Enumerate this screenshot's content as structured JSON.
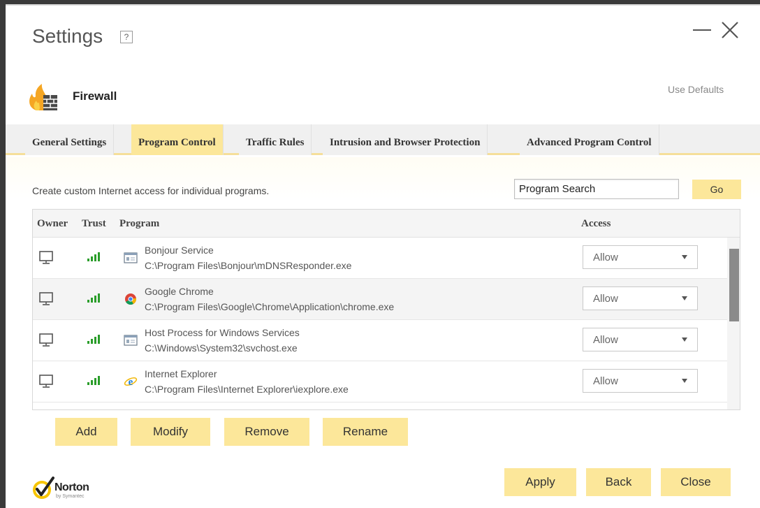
{
  "window": {
    "title": "Settings",
    "help_label": "?",
    "colors": {
      "accent": "#fce79a",
      "tab_active": "#fce79a"
    }
  },
  "section": {
    "title": "Firewall",
    "icon": "flame-wall-icon",
    "use_defaults": "Use Defaults"
  },
  "tabs": [
    {
      "label": "General Settings",
      "active": false
    },
    {
      "label": "Program Control",
      "active": true
    },
    {
      "label": "Traffic Rules",
      "active": false
    },
    {
      "label": "Intrusion and Browser Protection",
      "active": false
    },
    {
      "label": "Advanced Program Control",
      "active": false
    }
  ],
  "program_control": {
    "description": "Create custom Internet access for individual programs.",
    "search": {
      "value": "Program Search",
      "button": "Go"
    },
    "columns": {
      "owner": "Owner",
      "trust": "Trust",
      "program": "Program",
      "access": "Access"
    },
    "rows": [
      {
        "owner_icon": "computer-icon",
        "trust_icon": "trust-bars-icon",
        "program_icon": "application-window-icon",
        "name": "Bonjour Service",
        "path": "C:\\Program Files\\Bonjour\\mDNSResponder.exe",
        "access": "Allow"
      },
      {
        "owner_icon": "computer-icon",
        "trust_icon": "trust-bars-icon",
        "program_icon": "chrome-icon",
        "name": "Google Chrome",
        "path": "C:\\Program Files\\Google\\Chrome\\Application\\chrome.exe",
        "access": "Allow"
      },
      {
        "owner_icon": "computer-icon",
        "trust_icon": "trust-bars-icon",
        "program_icon": "application-window-icon",
        "name": "Host Process for Windows Services",
        "path": "C:\\Windows\\System32\\svchost.exe",
        "access": "Allow"
      },
      {
        "owner_icon": "computer-icon",
        "trust_icon": "trust-bars-icon",
        "program_icon": "internet-explorer-icon",
        "name": "Internet Explorer",
        "path": "C:\\Program Files\\Internet Explorer\\iexplore.exe",
        "access": "Allow"
      }
    ],
    "actions": {
      "add": "Add",
      "modify": "Modify",
      "remove": "Remove",
      "rename": "Rename"
    }
  },
  "footer": {
    "brand": "Norton",
    "brand_sub": "by Symantec",
    "apply": "Apply",
    "back": "Back",
    "close": "Close"
  }
}
